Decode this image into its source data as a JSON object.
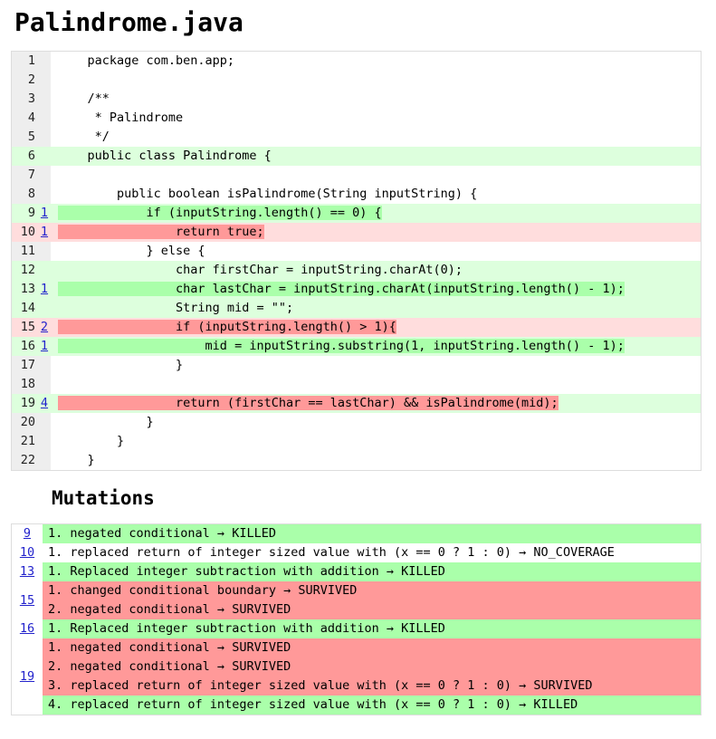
{
  "title": "Palindrome.java",
  "sections": {
    "mutations_heading": "Mutations"
  },
  "colors": {
    "line_covered": "#ddffdd",
    "line_survived": "#ffdddd",
    "mutation_killed": "#aaffaa",
    "mutation_survived": "#ff9999",
    "gutter": "#eeeeee",
    "link": "#2222cc",
    "border": "#dddddd"
  },
  "source": {
    "lines": [
      {
        "n": "1",
        "mutations": "",
        "status": "none",
        "parts": [
          {
            "t": "    package com.ben.app;",
            "k": "plain"
          }
        ]
      },
      {
        "n": "2",
        "mutations": "",
        "status": "none",
        "parts": [
          {
            "t": "",
            "k": "plain"
          }
        ]
      },
      {
        "n": "3",
        "mutations": "",
        "status": "none",
        "parts": [
          {
            "t": "    /**",
            "k": "plain"
          }
        ]
      },
      {
        "n": "4",
        "mutations": "",
        "status": "none",
        "parts": [
          {
            "t": "     * Palindrome",
            "k": "plain"
          }
        ]
      },
      {
        "n": "5",
        "mutations": "",
        "status": "none",
        "parts": [
          {
            "t": "     */",
            "k": "plain"
          }
        ]
      },
      {
        "n": "6",
        "mutations": "",
        "status": "cov",
        "parts": [
          {
            "t": "    public class Palindrome {",
            "k": "plain"
          }
        ]
      },
      {
        "n": "7",
        "mutations": "",
        "status": "none",
        "parts": [
          {
            "t": "",
            "k": "plain"
          }
        ]
      },
      {
        "n": "8",
        "mutations": "",
        "status": "none",
        "parts": [
          {
            "t": "        public boolean isPalindrome(String inputString) {",
            "k": "plain"
          }
        ]
      },
      {
        "n": "9",
        "mutations": "1",
        "status": "cov",
        "parts": [
          {
            "t": "            if (inputString.length() == 0) {",
            "k": "mut-killed"
          }
        ]
      },
      {
        "n": "10",
        "mutations": "1",
        "status": "surv",
        "parts": [
          {
            "t": "                return true;",
            "k": "mut-survived"
          }
        ]
      },
      {
        "n": "11",
        "mutations": "",
        "status": "none",
        "parts": [
          {
            "t": "            } else {",
            "k": "plain"
          }
        ]
      },
      {
        "n": "12",
        "mutations": "",
        "status": "cov",
        "parts": [
          {
            "t": "                char firstChar = inputString.charAt(0);",
            "k": "plain"
          }
        ]
      },
      {
        "n": "13",
        "mutations": "1",
        "status": "cov",
        "parts": [
          {
            "t": "                char lastChar = inputString.charAt(inputString.length() - 1);",
            "k": "mut-killed"
          }
        ]
      },
      {
        "n": "14",
        "mutations": "",
        "status": "cov",
        "parts": [
          {
            "t": "                String mid = \"\";",
            "k": "plain"
          }
        ]
      },
      {
        "n": "15",
        "mutations": "2",
        "status": "surv",
        "parts": [
          {
            "t": "                if (inputString.length() > 1){",
            "k": "mut-survived"
          }
        ]
      },
      {
        "n": "16",
        "mutations": "1",
        "status": "cov",
        "parts": [
          {
            "t": "                    mid = inputString.substring(1, inputString.length() - 1);",
            "k": "mut-killed"
          }
        ]
      },
      {
        "n": "17",
        "mutations": "",
        "status": "none",
        "parts": [
          {
            "t": "                }",
            "k": "plain"
          }
        ]
      },
      {
        "n": "18",
        "mutations": "",
        "status": "none",
        "parts": [
          {
            "t": "",
            "k": "plain"
          }
        ]
      },
      {
        "n": "19",
        "mutations": "4",
        "status": "cov",
        "parts": [
          {
            "t": "                return (firstChar == lastChar) && isPalindrome(mid);",
            "k": "mut-survived"
          }
        ]
      },
      {
        "n": "20",
        "mutations": "",
        "status": "none",
        "parts": [
          {
            "t": "            }",
            "k": "plain"
          }
        ]
      },
      {
        "n": "21",
        "mutations": "",
        "status": "none",
        "parts": [
          {
            "t": "        }",
            "k": "plain"
          }
        ]
      },
      {
        "n": "22",
        "mutations": "",
        "status": "none",
        "parts": [
          {
            "t": "    }",
            "k": "plain"
          }
        ]
      }
    ]
  },
  "mutations": {
    "groups": [
      {
        "line": "9",
        "items": [
          {
            "index": "1.",
            "description": "negated conditional",
            "arrow": "→",
            "status": "KILLED"
          }
        ]
      },
      {
        "line": "10",
        "items": [
          {
            "index": "1.",
            "description": "replaced return of integer sized value with (x == 0 ? 1 : 0)",
            "arrow": "→",
            "status": "NO_COVERAGE"
          }
        ]
      },
      {
        "line": "13",
        "items": [
          {
            "index": "1.",
            "description": "Replaced integer subtraction with addition",
            "arrow": "→",
            "status": "KILLED"
          }
        ]
      },
      {
        "line": "15",
        "items": [
          {
            "index": "1.",
            "description": "changed conditional boundary",
            "arrow": "→",
            "status": "SURVIVED"
          },
          {
            "index": "2.",
            "description": "negated conditional",
            "arrow": "→",
            "status": "SURVIVED"
          }
        ]
      },
      {
        "line": "16",
        "items": [
          {
            "index": "1.",
            "description": "Replaced integer subtraction with addition",
            "arrow": "→",
            "status": "KILLED"
          }
        ]
      },
      {
        "line": "19",
        "items": [
          {
            "index": "1.",
            "description": "negated conditional",
            "arrow": "→",
            "status": "SURVIVED"
          },
          {
            "index": "2.",
            "description": "negated conditional",
            "arrow": "→",
            "status": "SURVIVED"
          },
          {
            "index": "3.",
            "description": "replaced return of integer sized value with (x == 0 ? 1 : 0)",
            "arrow": "→",
            "status": "SURVIVED"
          },
          {
            "index": "4.",
            "description": "replaced return of integer sized value with (x == 0 ? 1 : 0)",
            "arrow": "→",
            "status": "KILLED"
          }
        ]
      }
    ]
  }
}
